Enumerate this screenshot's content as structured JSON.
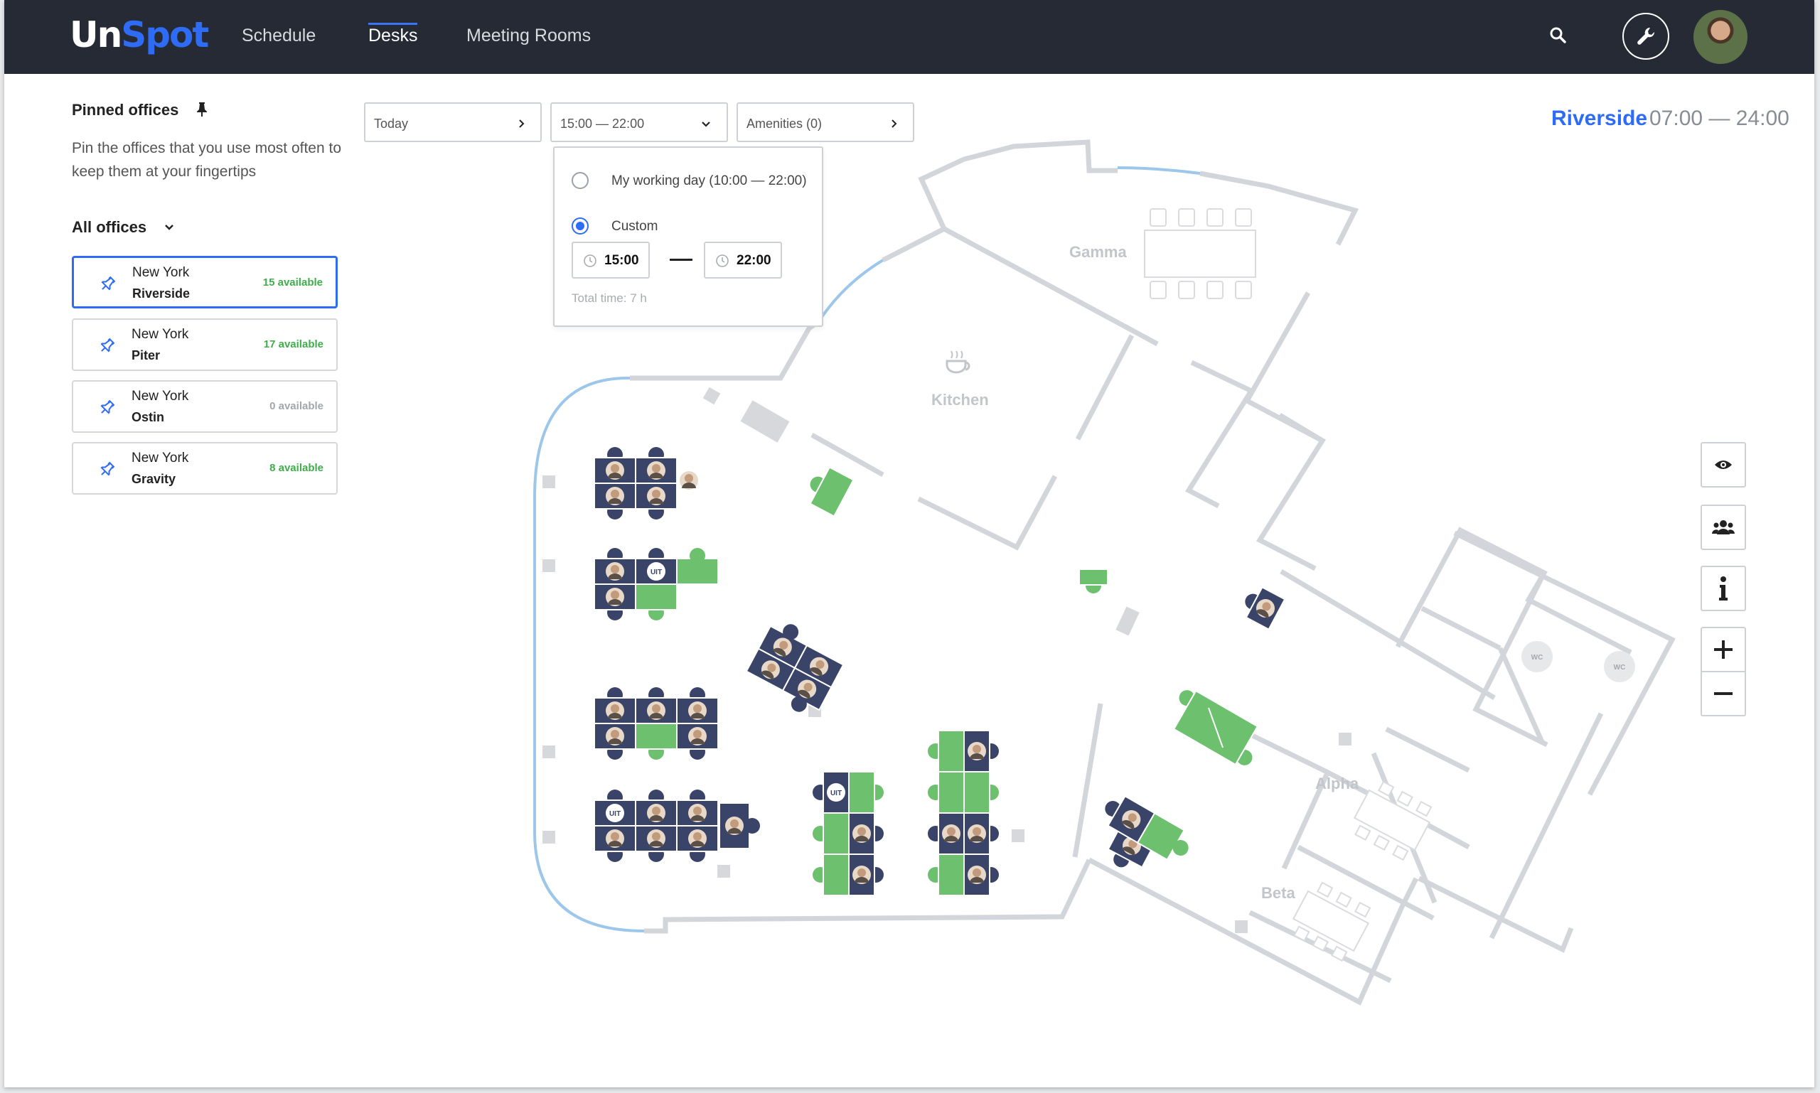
{
  "topbar": {
    "logo_un": "Un",
    "logo_spot": "Spot",
    "nav": [
      {
        "label": "Schedule",
        "active": false
      },
      {
        "label": "Desks",
        "active": true
      },
      {
        "label": "Meeting Rooms",
        "active": false
      }
    ],
    "icons": {
      "search": "search-icon",
      "settings": "wrench-icon",
      "avatar": "user-avatar"
    }
  },
  "sidebar": {
    "pinned_title": "Pinned offices",
    "pinned_desc": "Pin the offices that you use most often to keep them at your fingertips",
    "all_offices_label": "All offices",
    "offices": [
      {
        "city": "New York",
        "name": "Riverside",
        "available": "15 available",
        "selected": true
      },
      {
        "city": "New York",
        "name": "Piter",
        "available": "17 available",
        "selected": false
      },
      {
        "city": "New York",
        "name": "Ostin",
        "available": "0 available",
        "selected": false
      },
      {
        "city": "New York",
        "name": "Gravity",
        "available": "8 available",
        "selected": false
      }
    ]
  },
  "filters": {
    "date": "Today",
    "time": "15:00 — 22:00",
    "amenities": "Amenities (0)"
  },
  "time_dropdown": {
    "option_working_day": "My working day (10:00 — 22:00)",
    "option_custom": "Custom",
    "selected": "custom",
    "from": "15:00",
    "to": "22:00",
    "total": "Total time: 7 h"
  },
  "office_header": {
    "name": "Riverside",
    "hours": "07:00 — 24:00"
  },
  "floorplan": {
    "rooms": {
      "gamma": "Gamma",
      "kitchen": "Kitchen",
      "alpha": "Alpha",
      "beta": "Beta"
    },
    "wc_label": "WC",
    "uit_label": "UIT",
    "colors": {
      "available": "#6cc06e",
      "occupied": "#3a4468",
      "wall": "#d2d5da",
      "window": "#9cc6ea"
    }
  },
  "map_controls": [
    "eye-icon",
    "people-icon",
    "info-icon",
    "zoom-in-icon",
    "zoom-out-icon"
  ]
}
